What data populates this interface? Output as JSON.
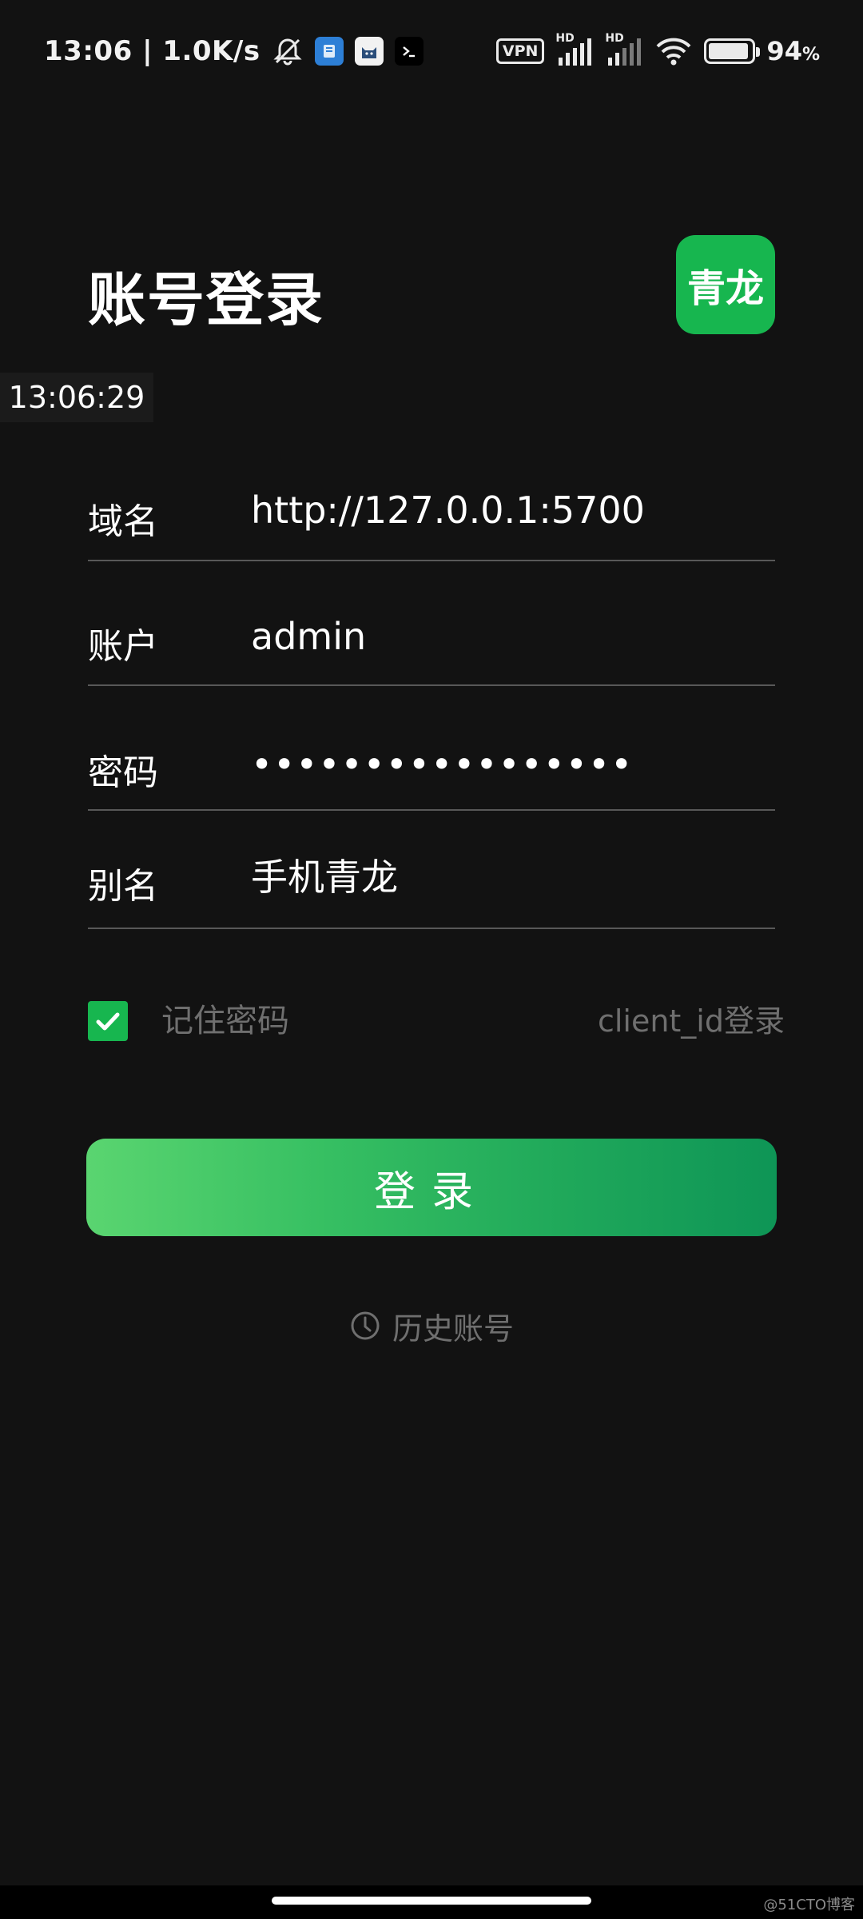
{
  "status_bar": {
    "time_speed": "13:06 | 1.0K/s",
    "vpn": "VPN",
    "hd1": "HD",
    "hd2": "HD",
    "battery_level": 94,
    "battery_pct": "94",
    "battery_unit": "%",
    "notification_icons": [
      "mute-icon",
      "app-blue-icon",
      "app-cat-icon",
      "terminal-icon"
    ]
  },
  "header": {
    "title": "账号登录",
    "logo_text": "青龙"
  },
  "floating_clock": "13:06:29",
  "form": {
    "domain_label": "域名",
    "domain_value": "http://127.0.0.1:5700",
    "account_label": "账户",
    "account_value": "admin",
    "password_label": "密码",
    "password_value": "•••••••••••••••••",
    "alias_label": "别名",
    "alias_value": "手机青龙"
  },
  "options": {
    "remember_checked": true,
    "remember_label": "记住密码",
    "client_login": "client_id登录"
  },
  "login_button": "登录",
  "history_link": "历史账号",
  "watermark": "@51CTO博客",
  "colors": {
    "background": "#121212",
    "accent_green": "#17b64f",
    "muted_text": "#6f6f6f",
    "divider": "#585858"
  }
}
